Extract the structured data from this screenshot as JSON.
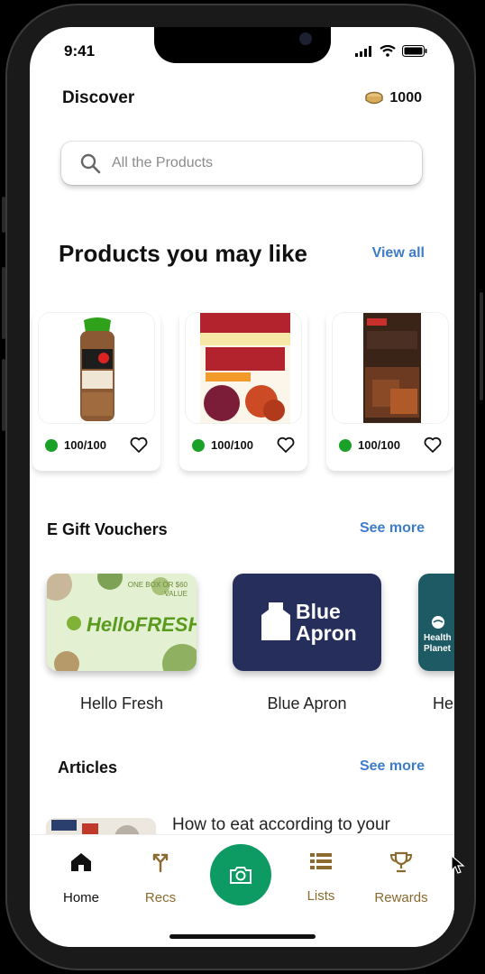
{
  "status": {
    "time": "9:41"
  },
  "header": {
    "title": "Discover",
    "coins": "1000"
  },
  "search": {
    "placeholder": "All the Products"
  },
  "products_section": {
    "title": "Products you may like",
    "link": "View all",
    "items": [
      {
        "score": "100/100"
      },
      {
        "score": "100/100"
      },
      {
        "score": "100/100"
      }
    ]
  },
  "vouchers_section": {
    "title": "E Gift Vouchers",
    "link": "See more",
    "items": [
      {
        "label": "Hello Fresh",
        "card_text": "HelloFRESH",
        "subtext": "ONE BOX OR $60 VALUE"
      },
      {
        "label": "Blue Apron",
        "card_text": "Blue Apron"
      },
      {
        "label": "He",
        "card_text": "Health Planet"
      }
    ]
  },
  "articles_section": {
    "title": "Articles",
    "link": "See more",
    "items": [
      {
        "title": "How to eat according to your"
      }
    ]
  },
  "nav": {
    "items": [
      {
        "label": "Home",
        "icon": "home-icon"
      },
      {
        "label": "Recs",
        "icon": "recs-icon"
      },
      {
        "label": "Lists",
        "icon": "list-icon"
      },
      {
        "label": "Rewards",
        "icon": "trophy-icon"
      }
    ]
  },
  "colors": {
    "accent": "#0e9a63",
    "link": "#3d7cc9",
    "score_dot": "#1aa127",
    "nav_inactive": "#8a6a2e"
  }
}
